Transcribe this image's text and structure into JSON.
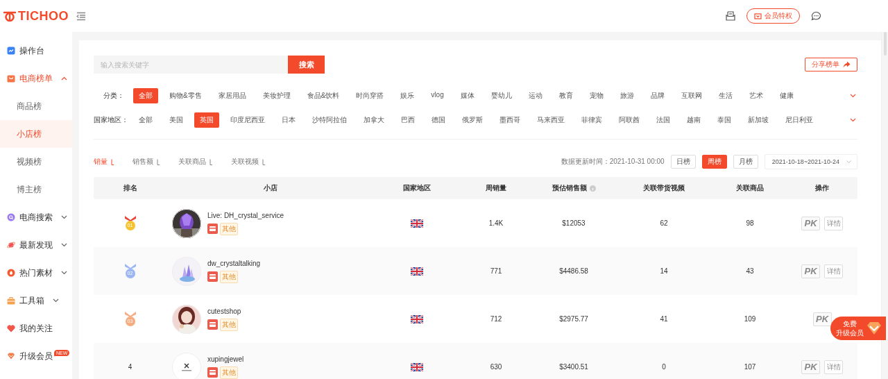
{
  "header": {
    "logo": "TICHOO",
    "vip_button": "会员特权"
  },
  "sidebar": {
    "items": [
      {
        "label": "操作台",
        "selected": false
      },
      {
        "label": "电商榜单",
        "selected": true,
        "expanded": true,
        "children": [
          {
            "label": "商品榜",
            "selected": false
          },
          {
            "label": "小店榜",
            "selected": true
          },
          {
            "label": "视频榜",
            "selected": false
          },
          {
            "label": "博主榜",
            "selected": false
          }
        ]
      },
      {
        "label": "电商搜索",
        "selected": false,
        "expanded": false
      },
      {
        "label": "最新发现",
        "selected": false,
        "expanded": false
      },
      {
        "label": "热门素材",
        "selected": false,
        "expanded": false
      },
      {
        "label": "工具箱",
        "selected": false,
        "expanded": false
      },
      {
        "label": "我的关注",
        "selected": false
      },
      {
        "label": "升级会员",
        "selected": false,
        "badge": "NEW"
      }
    ]
  },
  "search": {
    "placeholder": "输入搜索关键字",
    "button": "搜索"
  },
  "share_button": "分享榜单",
  "filters": [
    {
      "label": "分类：",
      "options": [
        {
          "label": "全部",
          "selected": true
        },
        {
          "label": "购物&零售",
          "selected": false
        },
        {
          "label": "家居用品",
          "selected": false
        },
        {
          "label": "美妆护理",
          "selected": false
        },
        {
          "label": "食品&饮料",
          "selected": false
        },
        {
          "label": "时尚穿搭",
          "selected": false
        },
        {
          "label": "娱乐",
          "selected": false
        },
        {
          "label": "vlog",
          "selected": false
        },
        {
          "label": "媒体",
          "selected": false
        },
        {
          "label": "婴幼儿",
          "selected": false
        },
        {
          "label": "运动",
          "selected": false
        },
        {
          "label": "教育",
          "selected": false
        },
        {
          "label": "宠物",
          "selected": false
        },
        {
          "label": "旅游",
          "selected": false
        },
        {
          "label": "品牌",
          "selected": false
        },
        {
          "label": "互联网",
          "selected": false
        },
        {
          "label": "生活",
          "selected": false
        },
        {
          "label": "艺术",
          "selected": false
        },
        {
          "label": "健康",
          "selected": false
        }
      ]
    },
    {
      "label": "国家地区：",
      "options": [
        {
          "label": "全部",
          "selected": false
        },
        {
          "label": "美国",
          "selected": false
        },
        {
          "label": "英国",
          "selected": true
        },
        {
          "label": "印度尼西亚",
          "selected": false
        },
        {
          "label": "日本",
          "selected": false
        },
        {
          "label": "沙特阿拉伯",
          "selected": false
        },
        {
          "label": "加拿大",
          "selected": false
        },
        {
          "label": "巴西",
          "selected": false
        },
        {
          "label": "德国",
          "selected": false
        },
        {
          "label": "俄罗斯",
          "selected": false
        },
        {
          "label": "墨西哥",
          "selected": false
        },
        {
          "label": "马来西亚",
          "selected": false
        },
        {
          "label": "菲律宾",
          "selected": false
        },
        {
          "label": "阿联酋",
          "selected": false
        },
        {
          "label": "法国",
          "selected": false
        },
        {
          "label": "越南",
          "selected": false
        },
        {
          "label": "泰国",
          "selected": false
        },
        {
          "label": "新加坡",
          "selected": false
        },
        {
          "label": "尼日利亚",
          "selected": false
        }
      ]
    }
  ],
  "sort_tabs": [
    {
      "label": "销量",
      "selected": true
    },
    {
      "label": "销售额",
      "selected": false
    },
    {
      "label": "关联商品",
      "selected": false
    },
    {
      "label": "关联视频",
      "selected": false
    }
  ],
  "update_time": "数据更新时间：2021-10-31 00:00",
  "periods": [
    {
      "label": "日榜",
      "selected": false
    },
    {
      "label": "周榜",
      "selected": true
    },
    {
      "label": "月榜",
      "selected": false
    }
  ],
  "date_range": "2021-10-18~2021-10-24",
  "table": {
    "columns": [
      {
        "label": "排名"
      },
      {
        "label": "小店"
      },
      {
        "label": "国家地区"
      },
      {
        "label": "周销量"
      },
      {
        "label": "预估销售额",
        "info": true
      },
      {
        "label": "关联带货视频"
      },
      {
        "label": "关联商品"
      },
      {
        "label": "操作"
      }
    ],
    "rows": [
      {
        "rank": {
          "kind": "medal",
          "label": "01",
          "color": "#f5c230"
        },
        "shop": "Live: DH_crystal_service",
        "tag": "其他",
        "weekly_sales": "1.4K",
        "revenue": "$12053",
        "videos": "62",
        "products": "98",
        "actions": [
          "PK",
          "详情"
        ]
      },
      {
        "rank": {
          "kind": "medal",
          "label": "02",
          "color": "#9bb6f2"
        },
        "shop": "dw_crystaltalking",
        "tag": "其他",
        "weekly_sales": "771",
        "revenue": "$4486.58",
        "videos": "14",
        "products": "43",
        "actions": [
          "PK",
          "详情"
        ]
      },
      {
        "rank": {
          "kind": "medal",
          "label": "03",
          "color": "#f6ab80"
        },
        "shop": "cutestshop",
        "tag": "其他",
        "weekly_sales": "712",
        "revenue": "$2975.77",
        "videos": "41",
        "products": "109",
        "actions": [
          "PK"
        ]
      },
      {
        "rank": {
          "kind": "number",
          "label": "4"
        },
        "shop": "xupingjewel",
        "tag": "其他",
        "weekly_sales": "630",
        "revenue": "$3400.51",
        "videos": "0",
        "products": "107",
        "actions": [
          "PK",
          "详情"
        ]
      }
    ]
  },
  "promo": {
    "lines": [
      "免费",
      "升级会员"
    ]
  }
}
